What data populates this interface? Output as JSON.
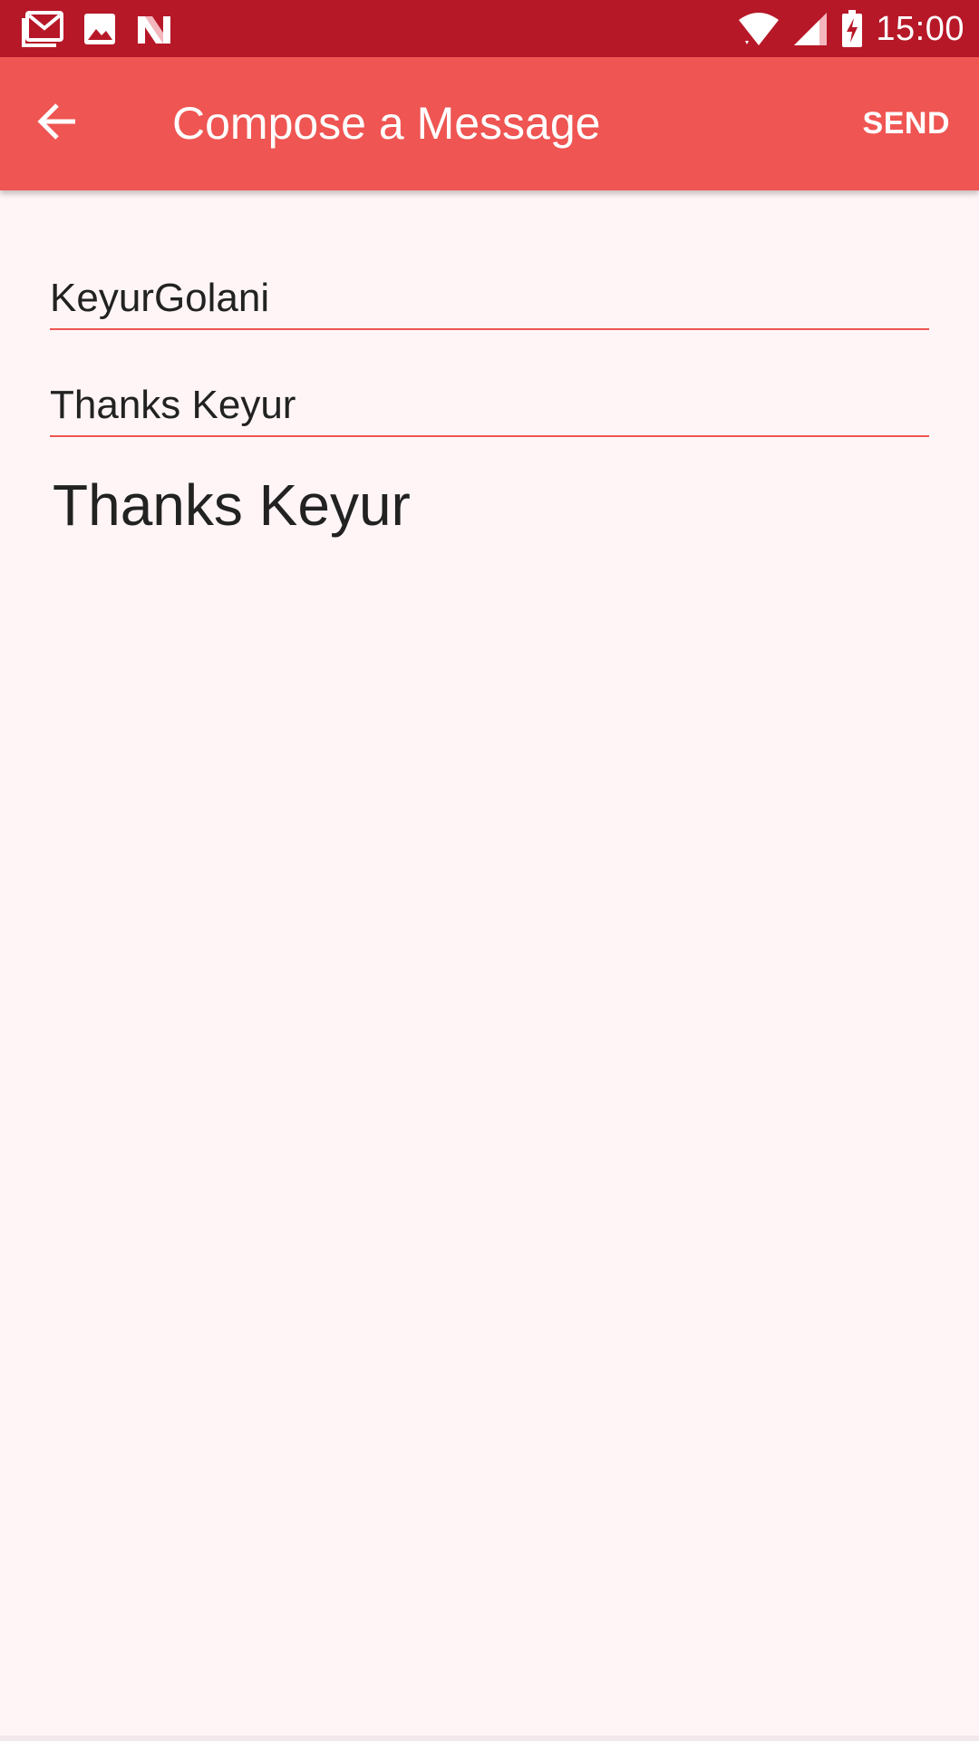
{
  "status_bar": {
    "time": "15:00",
    "left_icons": [
      "gmail-icon",
      "photo-icon",
      "n-logo-icon"
    ],
    "right_icons": [
      "wifi-icon",
      "cell-signal-icon",
      "battery-charging-icon"
    ],
    "background": "#b71828"
  },
  "app_bar": {
    "title": "Compose a Message",
    "action_label": "SEND",
    "back_icon": "arrow-back-icon",
    "background": "#ef5552"
  },
  "compose": {
    "to_value": "KeyurGolani",
    "subject_value": "Thanks Keyur",
    "message_text": "Thanks Keyur",
    "accent_color": "#ef5552"
  }
}
